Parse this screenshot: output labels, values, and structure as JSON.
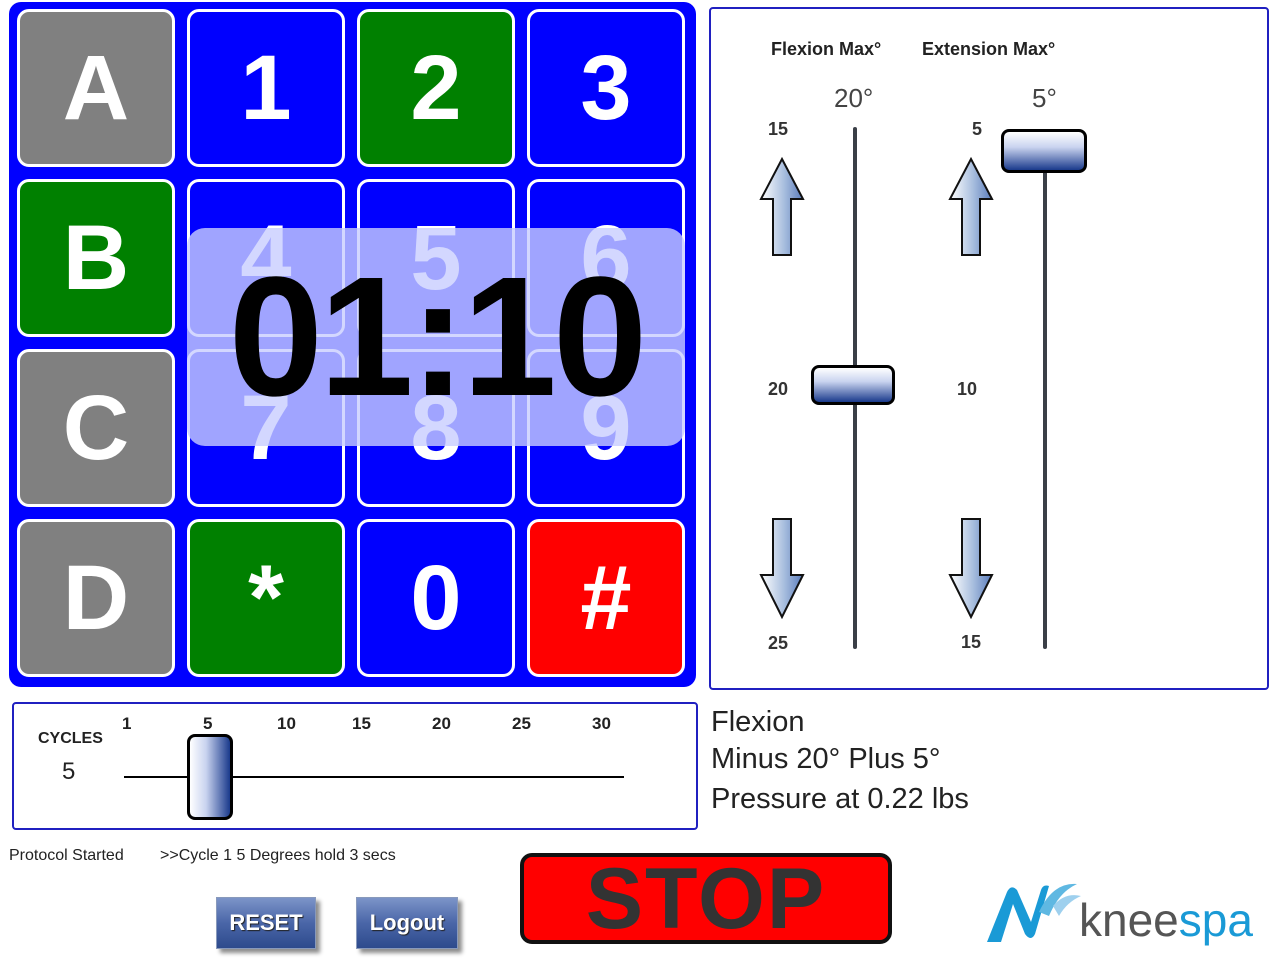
{
  "keypad": {
    "keys": [
      {
        "label": "A",
        "color": "gray"
      },
      {
        "label": "1",
        "color": "blue"
      },
      {
        "label": "2",
        "color": "green"
      },
      {
        "label": "3",
        "color": "blue"
      },
      {
        "label": "B",
        "color": "green"
      },
      {
        "label": "4",
        "color": "blue"
      },
      {
        "label": "5",
        "color": "blue"
      },
      {
        "label": "6",
        "color": "blue"
      },
      {
        "label": "C",
        "color": "gray"
      },
      {
        "label": "7",
        "color": "blue"
      },
      {
        "label": "8",
        "color": "blue"
      },
      {
        "label": "9",
        "color": "blue"
      },
      {
        "label": "D",
        "color": "gray"
      },
      {
        "label": "*",
        "color": "green"
      },
      {
        "label": "0",
        "color": "blue"
      },
      {
        "label": "#",
        "color": "red"
      }
    ],
    "timer": "01:10"
  },
  "range": {
    "flexion": {
      "heading": "Flexion Max°",
      "value_label": "20°",
      "value": 20,
      "ticks": [
        "15",
        "20",
        "25"
      ]
    },
    "extension": {
      "heading": "Extension Max°",
      "value_label": "5°",
      "value": 5,
      "ticks": [
        "5",
        "10",
        "15"
      ]
    }
  },
  "cycles": {
    "label": "CYCLES",
    "value": "5",
    "ticks": [
      "1",
      "5",
      "10",
      "15",
      "20",
      "25",
      "30"
    ]
  },
  "info": {
    "mode": "Flexion",
    "range_text": "Minus 20° Plus 5°",
    "pressure_text": "Pressure at 0.22 lbs"
  },
  "status": {
    "left": "Protocol Started",
    "right": ">>Cycle 1 5 Degrees hold 3 secs"
  },
  "buttons": {
    "reset": "RESET",
    "logout": "Logout",
    "stop": "STOP"
  },
  "logo": {
    "text": "kneespa"
  },
  "colors": {
    "keypad_bg": "#0000ff",
    "key_blue": "#0000ff",
    "key_green": "#008000",
    "key_gray": "#808080",
    "key_red": "#ff0000",
    "panel_border": "#2020c0",
    "stop_red": "#ff0000",
    "logo_blue": "#1a9ad6"
  },
  "icons": {
    "flexion_up": "arrow-up-icon",
    "flexion_down": "arrow-down-icon",
    "extension_up": "arrow-up-icon",
    "extension_down": "arrow-down-icon"
  }
}
